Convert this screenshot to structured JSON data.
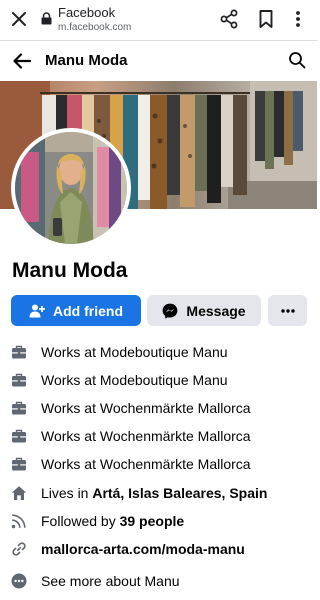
{
  "browser": {
    "title": "Facebook",
    "url": "m.facebook.com",
    "icons": [
      "close-icon",
      "lock-icon",
      "share-icon",
      "bookmark-icon",
      "overflow-menu-icon"
    ]
  },
  "header": {
    "title": "Manu Moda",
    "icons": [
      "back-arrow-icon",
      "search-icon"
    ]
  },
  "profile": {
    "name": "Manu Moda"
  },
  "actions": {
    "add_friend": "Add friend",
    "message": "Message",
    "more": "more-options-icon"
  },
  "details": {
    "work": [
      {
        "prefix": "Works at",
        "place": "Modeboutique Manu"
      },
      {
        "prefix": "Works at",
        "place": "Modeboutique Manu"
      },
      {
        "prefix": "Works at",
        "place": "Wochenmärkte Mallorca"
      },
      {
        "prefix": "Works at",
        "place": "Wochenmärkte Mallorca"
      },
      {
        "prefix": "Works at",
        "place": "Wochenmärkte Mallorca"
      }
    ],
    "lives_prefix": "Lives in",
    "lives_place": "Artá, Islas Baleares, Spain",
    "followed_prefix": "Followed by",
    "followed_count": "39 people",
    "website": "mallorca-arta.com/moda-manu",
    "see_more": "See more about Manu"
  },
  "colors": {
    "primary": "#1b74e4",
    "secondary_button": "#e4e6eb",
    "icon": "#606770"
  }
}
